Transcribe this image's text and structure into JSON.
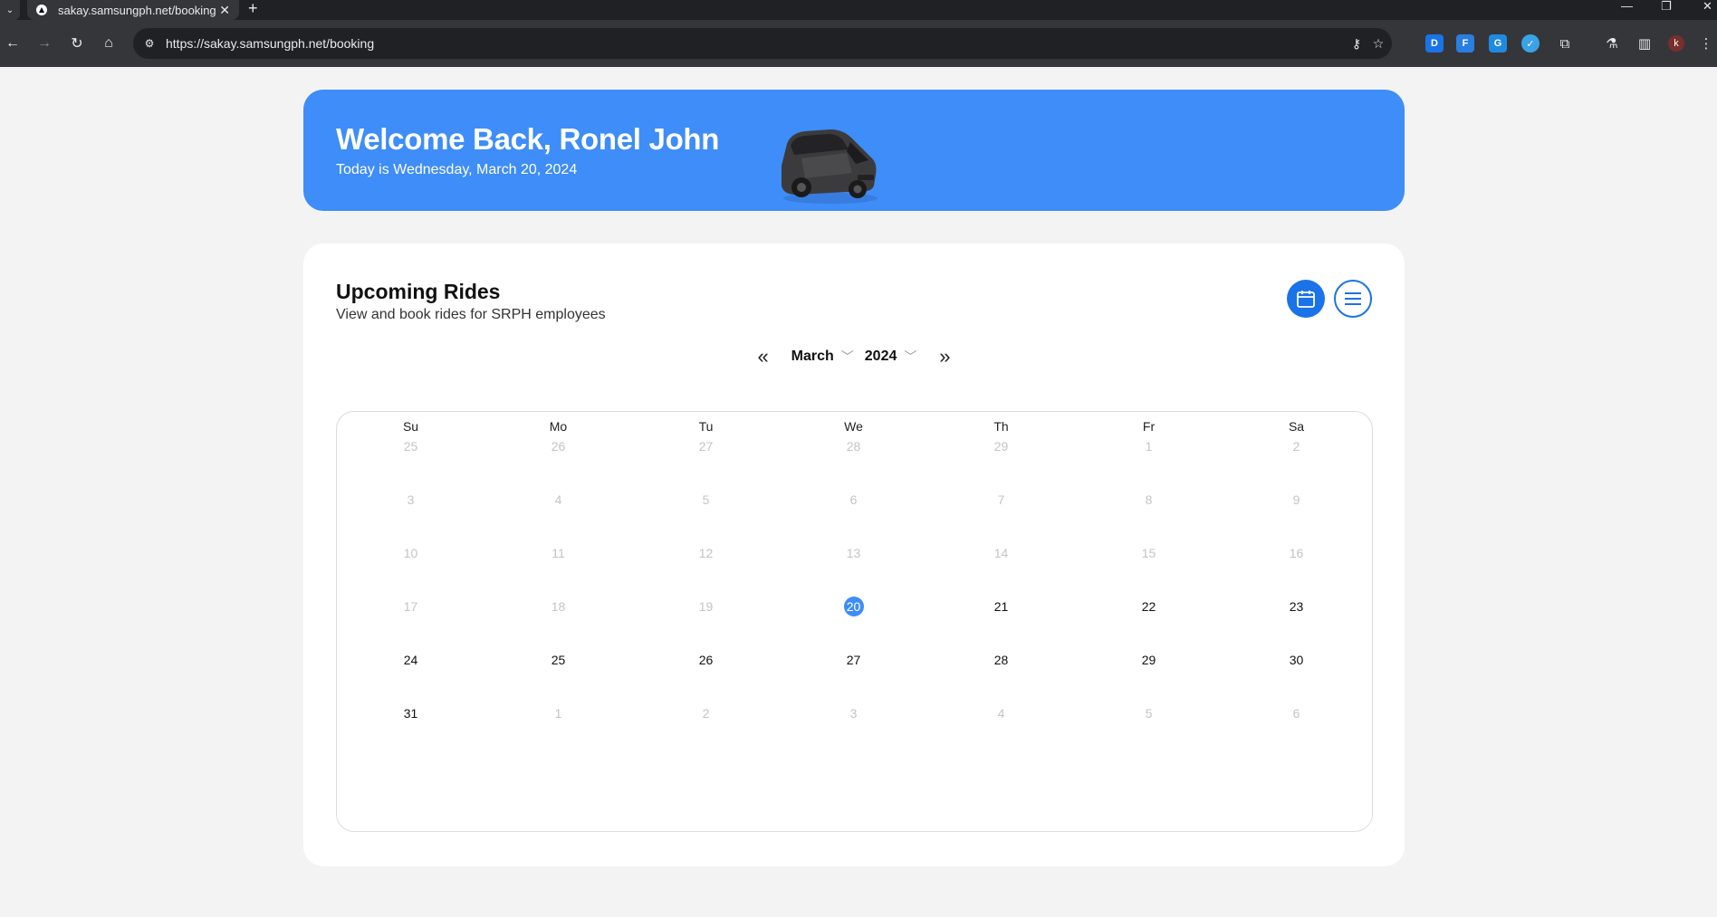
{
  "browser": {
    "tab_title": "sakay.samsungph.net/booking",
    "url": "https://sakay.samsungph.net/booking",
    "profile_initial": "k"
  },
  "hero": {
    "title": "Welcome Back, Ronel John",
    "date_text": "Today is Wednesday, March 20, 2024"
  },
  "rides": {
    "title": "Upcoming Rides",
    "subtitle": "View and book rides for SRPH employees",
    "month": "March",
    "year": "2024"
  },
  "calendar": {
    "weekdays": [
      "Su",
      "Mo",
      "Tu",
      "We",
      "Th",
      "Fr",
      "Sa"
    ],
    "weeks": [
      [
        {
          "d": "25",
          "s": "dim"
        },
        {
          "d": "26",
          "s": "dim"
        },
        {
          "d": "27",
          "s": "dim"
        },
        {
          "d": "28",
          "s": "dim"
        },
        {
          "d": "29",
          "s": "dim"
        },
        {
          "d": "1",
          "s": "dim"
        },
        {
          "d": "2",
          "s": "dim"
        }
      ],
      [
        {
          "d": "3",
          "s": "dim"
        },
        {
          "d": "4",
          "s": "dim"
        },
        {
          "d": "5",
          "s": "dim"
        },
        {
          "d": "6",
          "s": "dim"
        },
        {
          "d": "7",
          "s": "dim"
        },
        {
          "d": "8",
          "s": "dim"
        },
        {
          "d": "9",
          "s": "dim"
        }
      ],
      [
        {
          "d": "10",
          "s": "dim"
        },
        {
          "d": "11",
          "s": "dim"
        },
        {
          "d": "12",
          "s": "dim"
        },
        {
          "d": "13",
          "s": "dim"
        },
        {
          "d": "14",
          "s": "dim"
        },
        {
          "d": "15",
          "s": "dim"
        },
        {
          "d": "16",
          "s": "dim"
        }
      ],
      [
        {
          "d": "17",
          "s": "dim"
        },
        {
          "d": "18",
          "s": "dim"
        },
        {
          "d": "19",
          "s": "dim"
        },
        {
          "d": "20",
          "s": "today"
        },
        {
          "d": "21",
          "s": "active"
        },
        {
          "d": "22",
          "s": "active"
        },
        {
          "d": "23",
          "s": "active"
        }
      ],
      [
        {
          "d": "24",
          "s": "active"
        },
        {
          "d": "25",
          "s": "active"
        },
        {
          "d": "26",
          "s": "active"
        },
        {
          "d": "27",
          "s": "active"
        },
        {
          "d": "28",
          "s": "active"
        },
        {
          "d": "29",
          "s": "active"
        },
        {
          "d": "30",
          "s": "active"
        }
      ],
      [
        {
          "d": "31",
          "s": "active"
        },
        {
          "d": "1",
          "s": "dim"
        },
        {
          "d": "2",
          "s": "dim"
        },
        {
          "d": "3",
          "s": "dim"
        },
        {
          "d": "4",
          "s": "dim"
        },
        {
          "d": "5",
          "s": "dim"
        },
        {
          "d": "6",
          "s": "dim"
        }
      ]
    ]
  },
  "colors": {
    "accent": "#3e8df8",
    "button_blue": "#1a73e8"
  }
}
